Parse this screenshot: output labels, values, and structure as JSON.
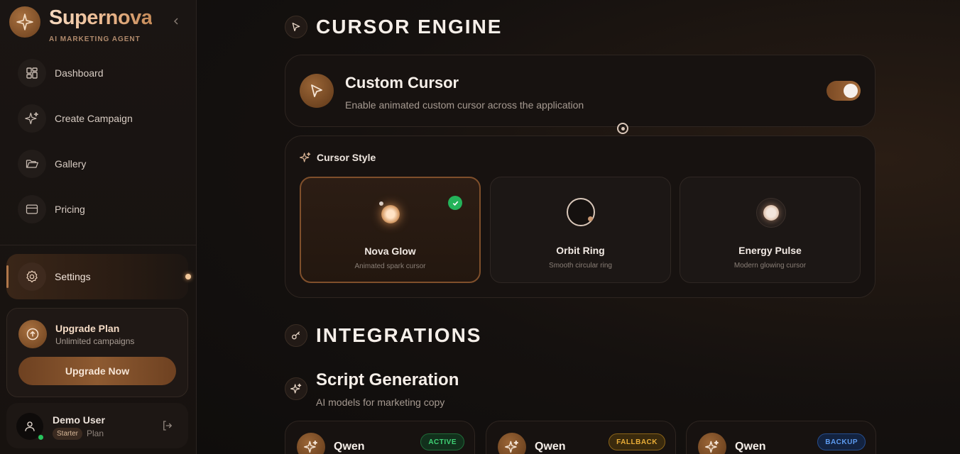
{
  "brand": {
    "name": "Supernova",
    "tagline": "AI MARKETING AGENT"
  },
  "nav": {
    "items": [
      {
        "label": "Dashboard",
        "icon": "dashboard-grid-icon"
      },
      {
        "label": "Create Campaign",
        "icon": "sparkle-icon"
      },
      {
        "label": "Gallery",
        "icon": "folder-open-icon"
      },
      {
        "label": "Pricing",
        "icon": "credit-card-icon"
      }
    ],
    "settings": {
      "label": "Settings",
      "icon": "gear-icon"
    }
  },
  "upgrade": {
    "title": "Upgrade Plan",
    "subtitle": "Unlimited campaigns",
    "button": "Upgrade Now"
  },
  "user": {
    "name": "Demo User",
    "plan_badge": "Starter",
    "plan_word": "Plan"
  },
  "cursor_engine": {
    "title": "CURSOR ENGINE",
    "custom_cursor": {
      "title": "Custom Cursor",
      "description": "Enable animated custom cursor across the application",
      "enabled": true
    },
    "style": {
      "label": "Cursor Style",
      "options": [
        {
          "name": "Nova Glow",
          "description": "Animated spark cursor",
          "selected": true
        },
        {
          "name": "Orbit Ring",
          "description": "Smooth circular ring",
          "selected": false
        },
        {
          "name": "Energy Pulse",
          "description": "Modern glowing cursor",
          "selected": false
        }
      ]
    }
  },
  "integrations": {
    "title": "INTEGRATIONS",
    "script_generation": {
      "title": "Script Generation",
      "description": "AI models for marketing copy",
      "models": [
        {
          "name": "Qwen",
          "badge": "ACTIVE"
        },
        {
          "name": "Qwen",
          "badge": "FALLBACK"
        },
        {
          "name": "Qwen",
          "badge": "BACKUP"
        }
      ]
    }
  },
  "colors": {
    "accent": "#a56c3b",
    "active": "#3fd275",
    "fallback": "#e9ad38",
    "backup": "#5e9cf0"
  }
}
